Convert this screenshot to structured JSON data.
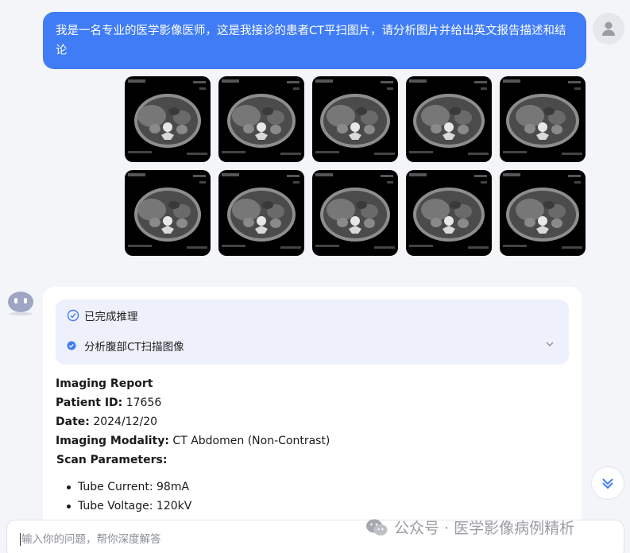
{
  "user_message": "我是一名专业的医学影像医师，这是我接诊的患者CT平扫图片，请分析图片并给出英文报告描述和结论",
  "ct_images": [
    {
      "alt": "ct-slice"
    },
    {
      "alt": "ct-slice"
    },
    {
      "alt": "ct-slice"
    },
    {
      "alt": "ct-slice"
    },
    {
      "alt": "ct-slice"
    },
    {
      "alt": "ct-slice"
    },
    {
      "alt": "ct-slice"
    },
    {
      "alt": "ct-slice"
    },
    {
      "alt": "ct-slice"
    },
    {
      "alt": "ct-slice"
    }
  ],
  "reasoning": {
    "status": "已完成推理",
    "step": "分析腹部CT扫描图像"
  },
  "report": {
    "title": "Imaging Report",
    "patient_id_label": "Patient ID:",
    "patient_id": "17656",
    "date_label": "Date:",
    "date": "2024/12/20",
    "modality_label": "Imaging Modality:",
    "modality": "CT Abdomen (Non-Contrast)",
    "params_label": "Scan Parameters:",
    "params": [
      "Tube Current: 98mA",
      "Tube Voltage: 120kV"
    ]
  },
  "input": {
    "placeholder": "输入你的问题，帮你深度解答"
  },
  "watermark": "公众号 · 医学影像病例精析",
  "colors": {
    "accent": "#3f7cf6",
    "background": "#f4f5f9",
    "reason_bg": "#eef1fb"
  }
}
